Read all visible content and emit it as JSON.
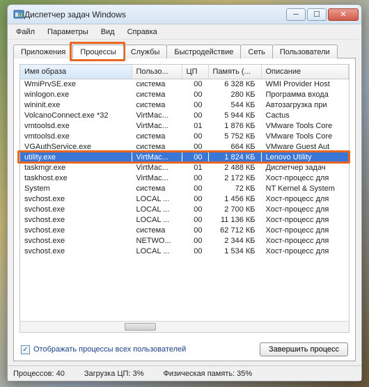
{
  "title": "Диспетчер задач Windows",
  "menu": [
    "Файл",
    "Параметры",
    "Вид",
    "Справка"
  ],
  "tabs": [
    "Приложения",
    "Процессы",
    "Службы",
    "Быстродействие",
    "Сеть",
    "Пользователи"
  ],
  "active_tab_index": 1,
  "columns": [
    "Имя образа",
    "Пользо...",
    "ЦП",
    "Память (...",
    "Описание"
  ],
  "rows": [
    {
      "img": "WmiPrvSE.exe",
      "user": "система",
      "cpu": "00",
      "mem": "6 328 КБ",
      "desc": "WMI Provider Host",
      "sel": false
    },
    {
      "img": "winlogon.exe",
      "user": "система",
      "cpu": "00",
      "mem": "280 КБ",
      "desc": "Программа входа",
      "sel": false
    },
    {
      "img": "wininit.exe",
      "user": "система",
      "cpu": "00",
      "mem": "544 КБ",
      "desc": "Автозагрузка при",
      "sel": false
    },
    {
      "img": "VolcanoConnect.exe *32",
      "user": "VirtMac...",
      "cpu": "00",
      "mem": "5 944 КБ",
      "desc": "Cactus",
      "sel": false
    },
    {
      "img": "vmtoolsd.exe",
      "user": "VirtMac...",
      "cpu": "01",
      "mem": "1 876 КБ",
      "desc": "VMware Tools Core",
      "sel": false
    },
    {
      "img": "vmtoolsd.exe",
      "user": "система",
      "cpu": "00",
      "mem": "5 752 КБ",
      "desc": "VMware Tools Core",
      "sel": false
    },
    {
      "img": "VGAuthService.exe",
      "user": "система",
      "cpu": "00",
      "mem": "664 КБ",
      "desc": "VMware Guest Aut",
      "sel": false
    },
    {
      "img": "utility.exe",
      "user": "VirtMac...",
      "cpu": "00",
      "mem": "1 824 КБ",
      "desc": "Lenovo Utility",
      "sel": true
    },
    {
      "img": "taskmgr.exe",
      "user": "VirtMac...",
      "cpu": "01",
      "mem": "2 488 КБ",
      "desc": "Диспетчер задач",
      "sel": false
    },
    {
      "img": "taskhost.exe",
      "user": "VirtMac...",
      "cpu": "00",
      "mem": "2 172 КБ",
      "desc": "Хост-процесс для",
      "sel": false
    },
    {
      "img": "System",
      "user": "система",
      "cpu": "00",
      "mem": "72 КБ",
      "desc": "NT Kernel & System",
      "sel": false
    },
    {
      "img": "svchost.exe",
      "user": "LOCAL ...",
      "cpu": "00",
      "mem": "1 456 КБ",
      "desc": "Хост-процесс для",
      "sel": false
    },
    {
      "img": "svchost.exe",
      "user": "LOCAL ...",
      "cpu": "00",
      "mem": "2 700 КБ",
      "desc": "Хост-процесс для",
      "sel": false
    },
    {
      "img": "svchost.exe",
      "user": "LOCAL ...",
      "cpu": "00",
      "mem": "11 136 КБ",
      "desc": "Хост-процесс для",
      "sel": false
    },
    {
      "img": "svchost.exe",
      "user": "система",
      "cpu": "00",
      "mem": "62 712 КБ",
      "desc": "Хост-процесс для",
      "sel": false
    },
    {
      "img": "svchost.exe",
      "user": "NETWO...",
      "cpu": "00",
      "mem": "2 344 КБ",
      "desc": "Хост-процесс для",
      "sel": false
    },
    {
      "img": "svchost.exe",
      "user": "LOCAL ...",
      "cpu": "00",
      "mem": "1 534 КБ",
      "desc": "Хост-процесс для",
      "sel": false
    }
  ],
  "checkbox_label": "Отображать процессы всех пользователей",
  "checkbox_checked": true,
  "end_button": "Завершить процесс",
  "status": {
    "processes": "Процессов: 40",
    "cpu": "Загрузка ЦП: 3%",
    "mem": "Физическая память: 35%"
  }
}
